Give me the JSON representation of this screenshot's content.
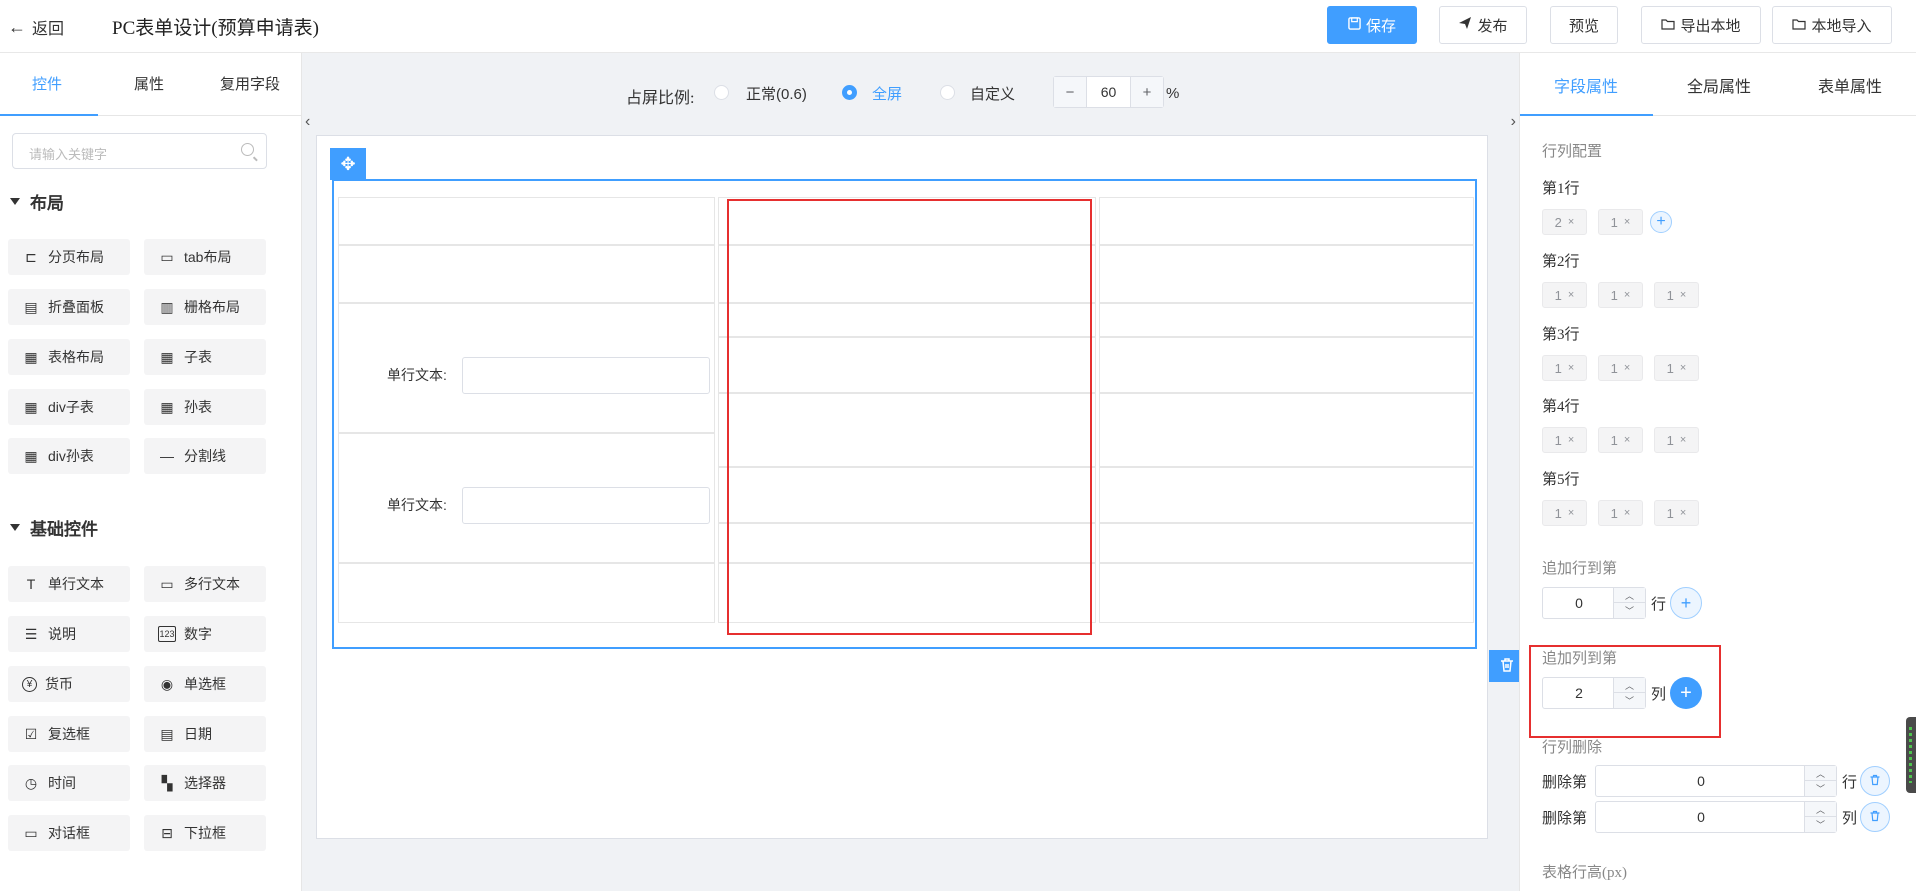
{
  "header": {
    "back_label": "返回",
    "title": "PC表单设计(预算申请表)",
    "buttons": {
      "save": "保存",
      "publish": "发布",
      "preview": "预览",
      "export": "导出本地",
      "import": "本地导入"
    }
  },
  "left_panel": {
    "tabs": [
      "控件",
      "属性",
      "复用字段"
    ],
    "active_tab": "控件",
    "search_placeholder": "请输入关键字",
    "sections": [
      {
        "title": "布局",
        "items": [
          "分页布局",
          "tab布局",
          "折叠面板",
          "栅格布局",
          "表格布局",
          "子表",
          "div子表",
          "孙表",
          "div孙表",
          "分割线"
        ]
      },
      {
        "title": "基础控件",
        "items": [
          "单行文本",
          "多行文本",
          "说明",
          "数字",
          "货币",
          "单选框",
          "复选框",
          "日期",
          "时间",
          "选择器",
          "对话框",
          "下拉框"
        ]
      }
    ]
  },
  "canvas": {
    "ratio_label": "占屏比例:",
    "ratio_options": [
      "正常(0.6)",
      "全屏",
      "自定义"
    ],
    "ratio_selected": "全屏",
    "custom_value": "60",
    "percent": "%",
    "field_label": "单行文本:"
  },
  "right_panel": {
    "tabs": [
      "字段属性",
      "全局属性",
      "表单属性"
    ],
    "active_tab": "字段属性",
    "row_col_config_label": "行列配置",
    "rows": [
      {
        "label": "第1行",
        "cols": [
          "2",
          "1"
        ]
      },
      {
        "label": "第2行",
        "cols": [
          "1",
          "1",
          "1"
        ]
      },
      {
        "label": "第3行",
        "cols": [
          "1",
          "1",
          "1"
        ]
      },
      {
        "label": "第4行",
        "cols": [
          "1",
          "1",
          "1"
        ]
      },
      {
        "label": "第5行",
        "cols": [
          "1",
          "1",
          "1"
        ]
      }
    ],
    "tag_close": "×",
    "append_row_label": "追加行到第",
    "append_row_value": "0",
    "append_row_unit": "行",
    "append_col_label": "追加列到第",
    "append_col_value": "2",
    "append_col_unit": "列",
    "delete_label": "行列删除",
    "delete_prefix": "删除第",
    "delete_row_value": "0",
    "delete_row_unit": "行",
    "delete_col_value": "0",
    "delete_col_unit": "列",
    "row_height_label": "表格行高(px)"
  },
  "colors": {
    "primary": "#409eff",
    "highlight": "#e62f2f"
  }
}
